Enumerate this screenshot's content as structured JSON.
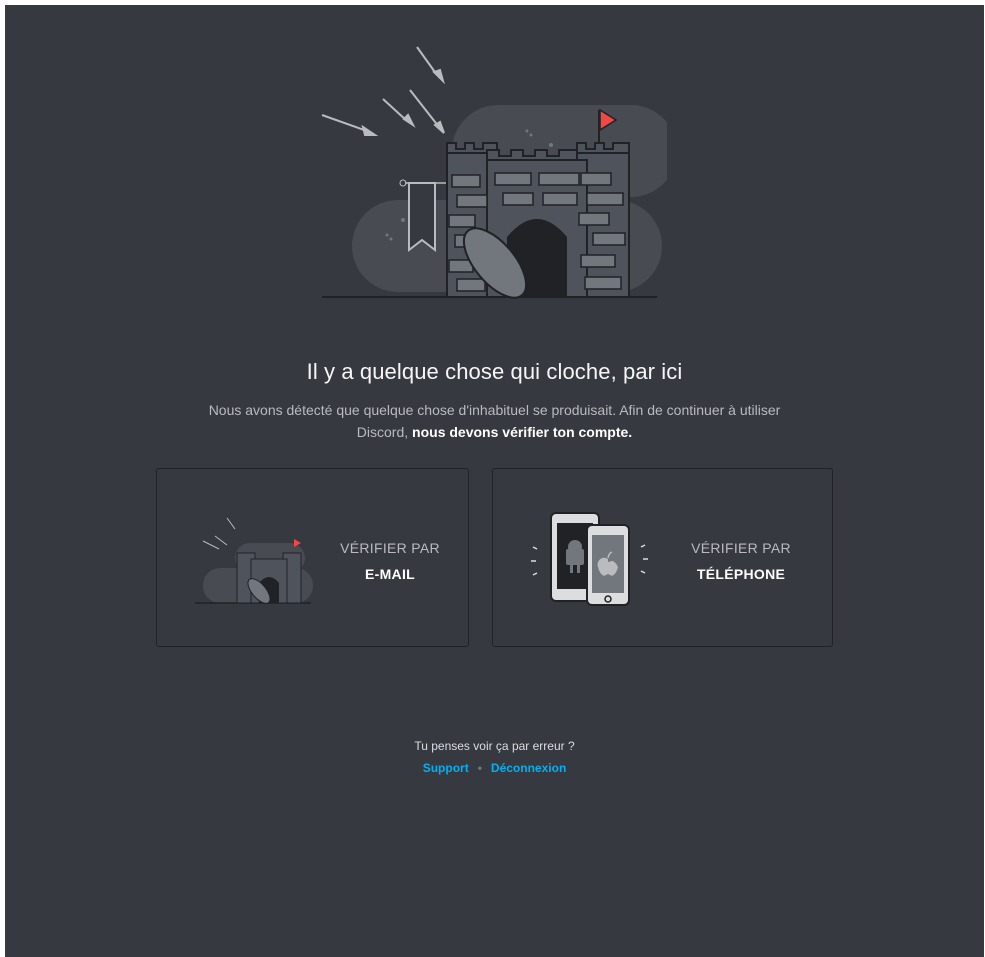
{
  "page": {
    "headline": "Il y a quelque chose qui cloche, par ici",
    "description_plain": "Nous avons détecté que quelque chose d'inhabituel se produisait. Afin de continuer à utiliser Discord,",
    "description_bold": "nous devons vérifier ton compte."
  },
  "options": {
    "email": {
      "line1": "VÉRIFIER PAR",
      "line2": "E-MAIL"
    },
    "phone": {
      "line1": "VÉRIFIER PAR",
      "line2": "TÉLÉPHONE"
    }
  },
  "footer": {
    "question": "Tu penses voir ça par erreur ?",
    "support": "Support",
    "separator": "•",
    "logout": "Déconnexion"
  },
  "icons": {
    "hero": "castle-under-siege-illustration",
    "email_card": "castle-illustration-small",
    "phone_card": "android-and-apple-phones-icon"
  },
  "colors": {
    "background": "#36393f",
    "card_border": "#202225",
    "link": "#00b0f4",
    "flag": "#f04747"
  }
}
